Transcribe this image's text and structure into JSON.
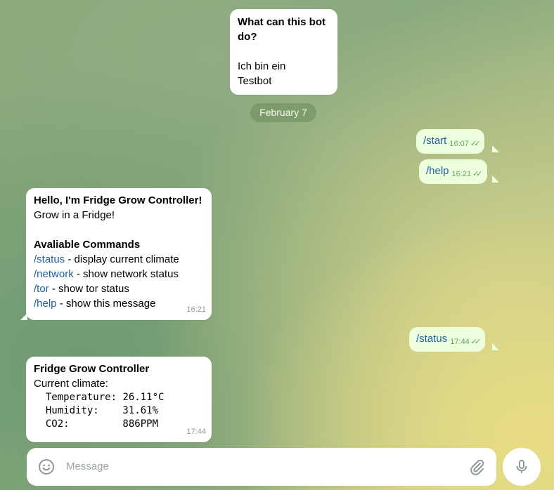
{
  "intro": {
    "title_line1": "What can this bot",
    "title_line2": "do?",
    "body_line1": "Ich bin ein",
    "body_line2": "Testbot"
  },
  "date_separator": "February 7",
  "outgoing": [
    {
      "text": "/start",
      "time": "16:07"
    },
    {
      "text": "/help",
      "time": "16:21"
    },
    {
      "text": "/status",
      "time": "17:44"
    }
  ],
  "help_message": {
    "greeting": "Hello, I'm Fridge Grow Controller!",
    "tagline": "Grow in a Fridge!",
    "heading": "Avaliable Commands",
    "commands": [
      {
        "cmd": "/status",
        "desc": " - display current climate"
      },
      {
        "cmd": "/network",
        "desc": " - show network status"
      },
      {
        "cmd": "/tor",
        "desc": " - show tor status"
      },
      {
        "cmd": "/help",
        "desc": " - show this message"
      }
    ],
    "time": "16:21"
  },
  "status_message": {
    "title": "Fridge Grow Controller",
    "subtitle": "Current climate:",
    "rows": [
      {
        "label": "  Temperature:",
        "value": " 26.11°C"
      },
      {
        "label": "  Humidity:",
        "value": "    31.61%"
      },
      {
        "label": "  CO2:",
        "value": "         886PPM"
      }
    ],
    "time": "17:44"
  },
  "composer": {
    "placeholder": "Message"
  },
  "icons": {
    "emoji": "emoji-icon",
    "attach": "paperclip-icon",
    "mic": "microphone-icon",
    "read": "double-check-icon"
  }
}
